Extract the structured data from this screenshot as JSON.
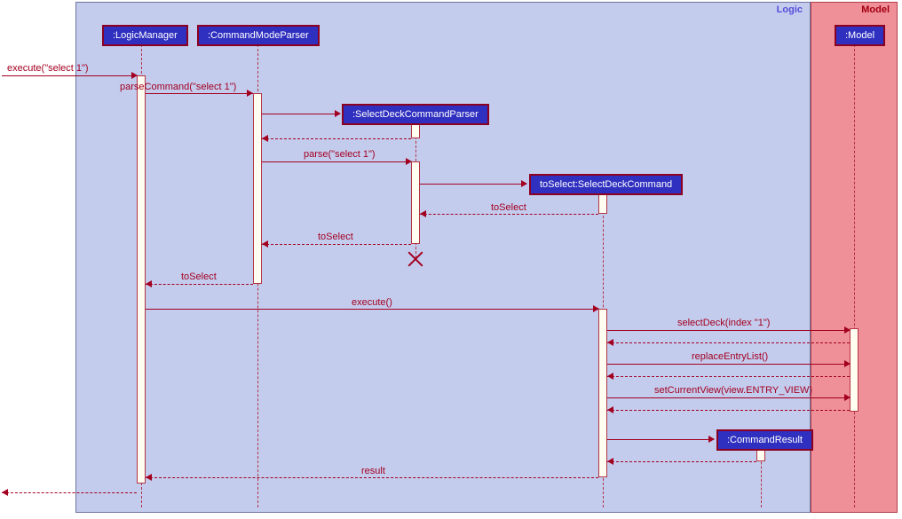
{
  "frames": {
    "logic": "Logic",
    "model": "Model"
  },
  "participants": {
    "logicManager": ":LogicManager",
    "commandModeParser": ":CommandModeParser",
    "selectDeckCommandParser": ":SelectDeckCommandParser",
    "selectDeckCommand": "toSelect:SelectDeckCommand",
    "commandResult": ":CommandResult",
    "model": ":Model"
  },
  "messages": {
    "execute1": "execute(\"select 1\")",
    "parseCommand": "parseCommand(\"select 1\")",
    "parse": "parse(\"select 1\")",
    "toSelect1": "toSelect",
    "toSelect2": "toSelect",
    "toSelect3": "toSelect",
    "execute2": "execute()",
    "selectDeck": "selectDeck(index \"1\")",
    "replaceEntryList": "replaceEntryList()",
    "setCurrentView": "setCurrentView(view.ENTRY_VIEW)",
    "result": "result"
  },
  "chart_data": {
    "type": "sequence-diagram",
    "frames": [
      "Logic",
      "Model"
    ],
    "participants": [
      {
        "name": ":LogicManager",
        "frame": "Logic"
      },
      {
        "name": ":CommandModeParser",
        "frame": "Logic"
      },
      {
        "name": ":SelectDeckCommandParser",
        "frame": "Logic",
        "created": true,
        "destroyed": true
      },
      {
        "name": "toSelect:SelectDeckCommand",
        "frame": "Logic",
        "created": true
      },
      {
        "name": ":CommandResult",
        "frame": "Logic",
        "created": true
      },
      {
        "name": ":Model",
        "frame": "Model"
      }
    ],
    "messages": [
      {
        "from": "external",
        "to": ":LogicManager",
        "label": "execute(\"select 1\")",
        "type": "call"
      },
      {
        "from": ":LogicManager",
        "to": ":CommandModeParser",
        "label": "parseCommand(\"select 1\")",
        "type": "call"
      },
      {
        "from": ":CommandModeParser",
        "to": ":SelectDeckCommandParser",
        "label": "",
        "type": "create"
      },
      {
        "from": ":SelectDeckCommandParser",
        "to": ":CommandModeParser",
        "label": "",
        "type": "return"
      },
      {
        "from": ":CommandModeParser",
        "to": ":SelectDeckCommandParser",
        "label": "parse(\"select 1\")",
        "type": "call"
      },
      {
        "from": ":SelectDeckCommandParser",
        "to": "toSelect:SelectDeckCommand",
        "label": "",
        "type": "create"
      },
      {
        "from": "toSelect:SelectDeckCommand",
        "to": ":SelectDeckCommandParser",
        "label": "toSelect",
        "type": "return"
      },
      {
        "from": ":SelectDeckCommandParser",
        "to": ":CommandModeParser",
        "label": "toSelect",
        "type": "return"
      },
      {
        "from": ":CommandModeParser",
        "to": ":LogicManager",
        "label": "toSelect",
        "type": "return"
      },
      {
        "from": ":LogicManager",
        "to": "toSelect:SelectDeckCommand",
        "label": "execute()",
        "type": "call"
      },
      {
        "from": "toSelect:SelectDeckCommand",
        "to": ":Model",
        "label": "selectDeck(index \"1\")",
        "type": "call"
      },
      {
        "from": ":Model",
        "to": "toSelect:SelectDeckCommand",
        "label": "",
        "type": "return"
      },
      {
        "from": "toSelect:SelectDeckCommand",
        "to": ":Model",
        "label": "replaceEntryList()",
        "type": "call"
      },
      {
        "from": ":Model",
        "to": "toSelect:SelectDeckCommand",
        "label": "",
        "type": "return"
      },
      {
        "from": "toSelect:SelectDeckCommand",
        "to": ":Model",
        "label": "setCurrentView(view.ENTRY_VIEW)",
        "type": "call"
      },
      {
        "from": ":Model",
        "to": "toSelect:SelectDeckCommand",
        "label": "",
        "type": "return"
      },
      {
        "from": "toSelect:SelectDeckCommand",
        "to": ":CommandResult",
        "label": "",
        "type": "create"
      },
      {
        "from": ":CommandResult",
        "to": "toSelect:SelectDeckCommand",
        "label": "",
        "type": "return"
      },
      {
        "from": "toSelect:SelectDeckCommand",
        "to": ":LogicManager",
        "label": "result",
        "type": "return"
      },
      {
        "from": ":LogicManager",
        "to": "external",
        "label": "",
        "type": "return"
      }
    ]
  }
}
